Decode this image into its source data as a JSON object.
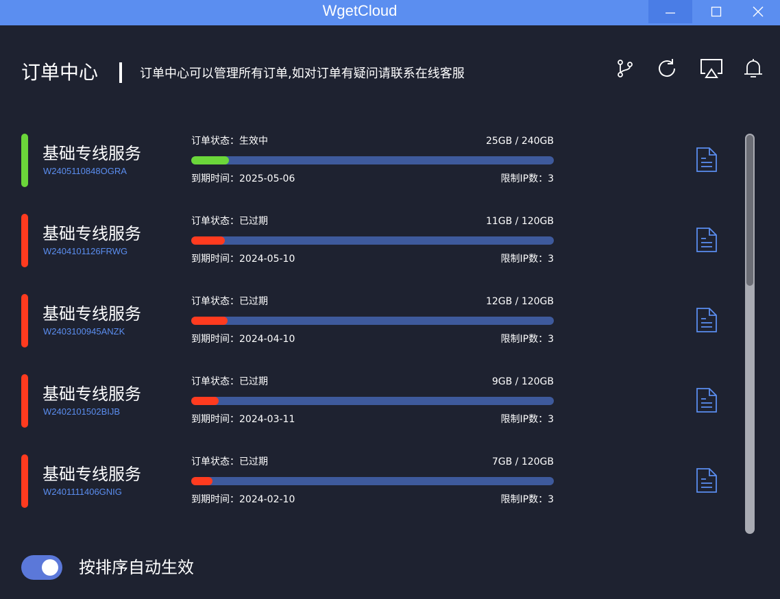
{
  "window": {
    "title": "WgetCloud",
    "accent": "#5b8ef0"
  },
  "header": {
    "title": "订单中心",
    "subtitle": "订单中心可以管理所有订单,如对订单有疑问请联系在线客服",
    "icons": [
      "branch-icon",
      "refresh-icon",
      "cast-icon",
      "bell-icon"
    ]
  },
  "orders": [
    {
      "name": "基础专线服务",
      "id": "W2405110848OGRA",
      "status": "订单状态：生效中",
      "usage": "25GB / 240GB",
      "usage_fraction": 0.104,
      "expire": "到期时间：2025-05-06",
      "ip_limit": "限制IP数：3",
      "color": "#6bd63a"
    },
    {
      "name": "基础专线服务",
      "id": "W2404101126FRWG",
      "status": "订单状态：已过期",
      "usage": "11GB / 120GB",
      "usage_fraction": 0.0917,
      "expire": "到期时间：2024-05-10",
      "ip_limit": "限制IP数：3",
      "color": "#ff3b1f"
    },
    {
      "name": "基础专线服务",
      "id": "W2403100945ANZK",
      "status": "订单状态：已过期",
      "usage": "12GB / 120GB",
      "usage_fraction": 0.1,
      "expire": "到期时间：2024-04-10",
      "ip_limit": "限制IP数：3",
      "color": "#ff3b1f"
    },
    {
      "name": "基础专线服务",
      "id": "W2402101502BIJB",
      "status": "订单状态：已过期",
      "usage": "9GB / 120GB",
      "usage_fraction": 0.075,
      "expire": "到期时间：2024-03-11",
      "ip_limit": "限制IP数：3",
      "color": "#ff3b1f"
    },
    {
      "name": "基础专线服务",
      "id": "W2401111406GNIG",
      "status": "订单状态：已过期",
      "usage": "7GB / 120GB",
      "usage_fraction": 0.0583,
      "expire": "到期时间：2024-02-10",
      "ip_limit": "限制IP数：3",
      "color": "#ff3b1f"
    }
  ],
  "footer": {
    "auto_activate_label": "按排序自动生效",
    "auto_activate_on": true
  }
}
